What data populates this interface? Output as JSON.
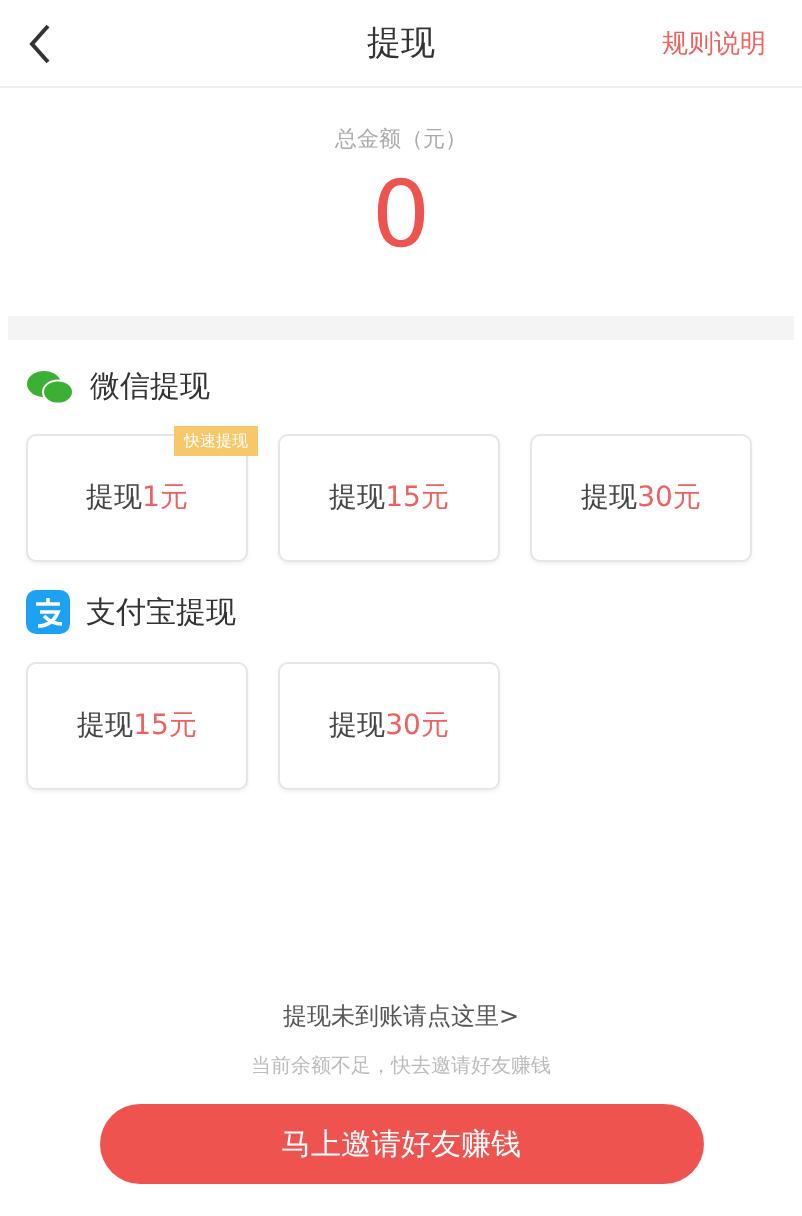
{
  "header": {
    "title": "提现",
    "action": "规则说明"
  },
  "balance": {
    "label": "总金额（元）",
    "amount": "0"
  },
  "sections": [
    {
      "kind": "wechat",
      "title": "微信提现",
      "options": [
        {
          "prefix": "提现",
          "amount": "1元",
          "badge": "快速提现"
        },
        {
          "prefix": "提现",
          "amount": "15元"
        },
        {
          "prefix": "提现",
          "amount": "30元"
        }
      ]
    },
    {
      "kind": "alipay",
      "title": "支付宝提现",
      "options": [
        {
          "prefix": "提现",
          "amount": "15元"
        },
        {
          "prefix": "提现",
          "amount": "30元"
        }
      ]
    }
  ],
  "footer": {
    "link": "提现未到账请点这里>",
    "hint": "当前余额不足，快去邀请好友赚钱",
    "button": "马上邀请好友赚钱"
  }
}
